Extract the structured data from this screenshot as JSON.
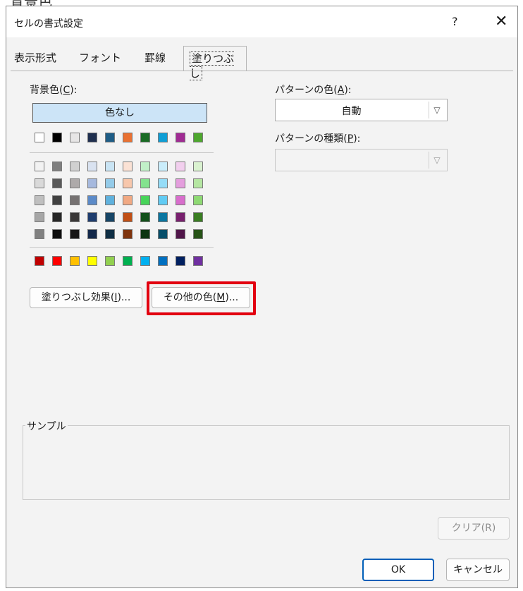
{
  "header_fragment": "背景色",
  "dialog": {
    "title": "セルの書式設定",
    "help": "?",
    "close": "✕"
  },
  "tabs": [
    {
      "label": "表示形式",
      "active": false
    },
    {
      "label": "フォント",
      "active": false
    },
    {
      "label": "罫線",
      "active": false
    },
    {
      "label": "塗りつぶし",
      "active": true
    }
  ],
  "fill": {
    "background_color_label": "背景色(",
    "background_color_key": "C",
    "background_color_suffix": "):",
    "no_color_label": "色なし",
    "standard_row": [
      "#ffffff",
      "#000000",
      "#e7e6e6",
      "#1f2f4f",
      "#1f5d86",
      "#e97132",
      "#196b24",
      "#0f9ed5",
      "#a02b93",
      "#4ea72e"
    ],
    "theme_rows": [
      [
        "#f2f2f2",
        "#7f7f7f",
        "#d0d0d0",
        "#d9e2f0",
        "#c9e4f4",
        "#fbe2d5",
        "#c1f0c8",
        "#caedfb",
        "#f2cfee",
        "#daf2d0"
      ],
      [
        "#d9d9d9",
        "#595959",
        "#aeaaaa",
        "#a6b9de",
        "#94cbe9",
        "#f7c7ac",
        "#83e28e",
        "#95dcf7",
        "#e49edd",
        "#b5e6a2"
      ],
      [
        "#bfbfbf",
        "#404040",
        "#757171",
        "#5b8ac8",
        "#5fb1dd",
        "#f1a983",
        "#47d459",
        "#61cbf3",
        "#d86ecc",
        "#8ed973"
      ],
      [
        "#a6a6a6",
        "#262626",
        "#3a3838",
        "#1e3d6e",
        "#174566",
        "#c04f15",
        "#124f1a",
        "#0b76a0",
        "#78206e",
        "#3a7d22"
      ],
      [
        "#808080",
        "#0d0d0d",
        "#171616",
        "#13284a",
        "#0f2e44",
        "#7f340d",
        "#0c3511",
        "#074f6a",
        "#501549",
        "#275317"
      ]
    ],
    "accent_row": [
      "#c00000",
      "#ff0000",
      "#ffc000",
      "#ffff00",
      "#92d050",
      "#00b050",
      "#00b0f0",
      "#0070c0",
      "#002060",
      "#7030a0"
    ],
    "fill_effects_button": {
      "pre": "塗りつぶし効果(",
      "key": "I",
      "post": ")..."
    },
    "more_colors_button": {
      "pre": "その他の色(",
      "key": "M",
      "post": ")..."
    },
    "pattern_color_label": {
      "pre": "パターンの色(",
      "key": "A",
      "post": "):"
    },
    "pattern_color_value": "自動",
    "pattern_style_label": {
      "pre": "パターンの種類(",
      "key": "P",
      "post": "):"
    },
    "pattern_style_value": ""
  },
  "sample_label": "サンプル",
  "clear_button": "クリア(R)",
  "ok_button": "OK",
  "cancel_button": "キャンセル",
  "colors": {
    "highlight": "#e20010",
    "selected_fill": "#cce4f7",
    "ok_border": "#005fb8"
  },
  "icons": {
    "dropdown": "▽"
  }
}
